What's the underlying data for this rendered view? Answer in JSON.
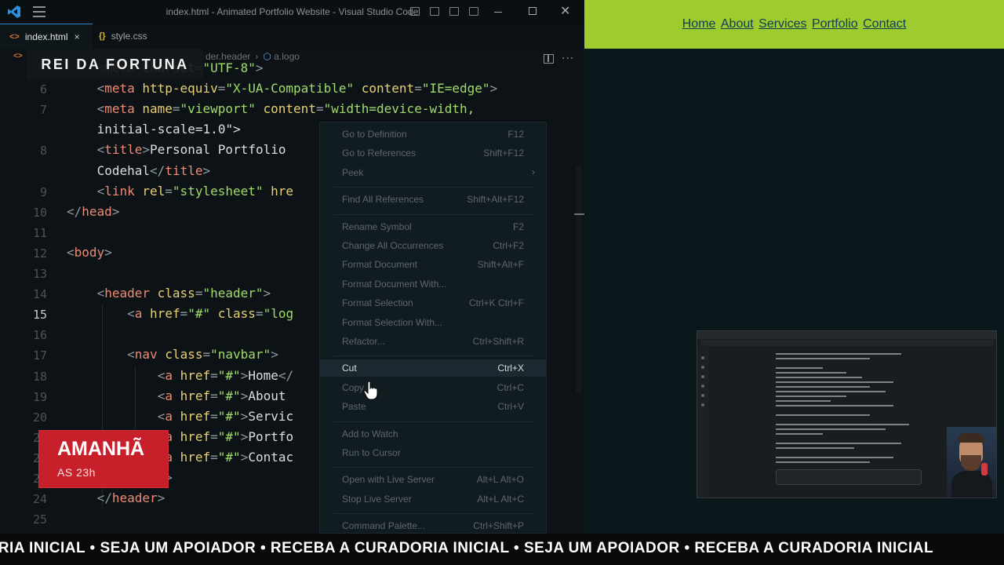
{
  "window": {
    "title": "index.html - Animated Portfolio Website - Visual Studio Code"
  },
  "tabs": [
    {
      "label": "index.html",
      "icon": "html-file-icon",
      "close": "×"
    },
    {
      "label": "style.css",
      "icon": "css-file-icon"
    }
  ],
  "breadcrumb": {
    "items": [
      "der.header",
      "a.logo"
    ]
  },
  "editor": {
    "lines": [
      {
        "num": "",
        "code": "    <meta charset=\"UTF-8\">"
      },
      {
        "num": "6",
        "code": "    <meta http-equiv=\"X-UA-Compatible\" content=\"IE=edge\">"
      },
      {
        "num": "7",
        "code": "    <meta name=\"viewport\" content=\"width=device-width,"
      },
      {
        "num": "",
        "code": "    initial-scale=1.0\">"
      },
      {
        "num": "8",
        "code": "    <title>Personal Portfolio"
      },
      {
        "num": "",
        "code": "    Codehal</title>"
      },
      {
        "num": "9",
        "code": "    <link rel=\"stylesheet\" hre"
      },
      {
        "num": "10",
        "code": "</head>"
      },
      {
        "num": "11",
        "code": ""
      },
      {
        "num": "12",
        "code": "<body>"
      },
      {
        "num": "13",
        "code": ""
      },
      {
        "num": "14",
        "code": "    <header class=\"header\">"
      },
      {
        "num": "15",
        "code": "        <a href=\"#\" class=\"log"
      },
      {
        "num": "16",
        "code": ""
      },
      {
        "num": "17",
        "code": "        <nav class=\"navbar\">"
      },
      {
        "num": "18",
        "code": "            <a href=\"#\">Home</"
      },
      {
        "num": "19",
        "code": "            <a href=\"#\">About"
      },
      {
        "num": "20",
        "code": "            <a href=\"#\">Servic"
      },
      {
        "num": "21",
        "code": "            <a href=\"#\">Portfo"
      },
      {
        "num": "22",
        "code": "            <a href=\"#\">Contac"
      },
      {
        "num": "23",
        "code": "        </nav>"
      },
      {
        "num": "24",
        "code": "    </header>"
      },
      {
        "num": "25",
        "code": ""
      }
    ],
    "active_line": "15"
  },
  "context_menu": {
    "items": [
      {
        "label": "Go to Definition",
        "key": "F12"
      },
      {
        "label": "Go to References",
        "key": "Shift+F12"
      },
      {
        "label": "Peek",
        "key": "",
        "submenu": true
      },
      {
        "separator": true
      },
      {
        "label": "Find All References",
        "key": "Shift+Alt+F12"
      },
      {
        "separator": true
      },
      {
        "label": "Rename Symbol",
        "key": "F2"
      },
      {
        "label": "Change All Occurrences",
        "key": "Ctrl+F2"
      },
      {
        "label": "Format Document",
        "key": "Shift+Alt+F"
      },
      {
        "label": "Format Document With...",
        "key": ""
      },
      {
        "label": "Format Selection",
        "key": "Ctrl+K Ctrl+F"
      },
      {
        "label": "Format Selection With...",
        "key": ""
      },
      {
        "label": "Refactor...",
        "key": "Ctrl+Shift+R"
      },
      {
        "separator": true
      },
      {
        "label": "Cut",
        "key": "Ctrl+X"
      },
      {
        "label": "Copy",
        "key": "Ctrl+C"
      },
      {
        "label": "Paste",
        "key": "Ctrl+V"
      },
      {
        "separator": true
      },
      {
        "label": "Add to Watch",
        "key": ""
      },
      {
        "label": "Run to Cursor",
        "key": ""
      },
      {
        "separator": true
      },
      {
        "label": "Open with Live Server",
        "key": "Alt+L Alt+O"
      },
      {
        "label": "Stop Live Server",
        "key": "Alt+L Alt+C"
      },
      {
        "separator": true
      },
      {
        "label": "Command Palette...",
        "key": "Ctrl+Shift+P"
      }
    ],
    "hovered": "Copy"
  },
  "preview": {
    "nav": [
      "Home",
      "About",
      "Services",
      "Portfolio",
      "Contact"
    ],
    "header_color": "#9ecb2e"
  },
  "overlay": {
    "channel": "REI DA FORTUNA",
    "schedule_day": "AMANHÃ",
    "schedule_time": "AS 23h",
    "ticker": "ADORIA INICIAL • SEJA UM APOIADOR • RECEBA A CURADORIA INICIAL • SEJA UM APOIADOR • RECEBA A CURADORIA INICIAL"
  },
  "colors": {
    "accent": "#2d7fd2",
    "card_red": "#c8202a"
  }
}
